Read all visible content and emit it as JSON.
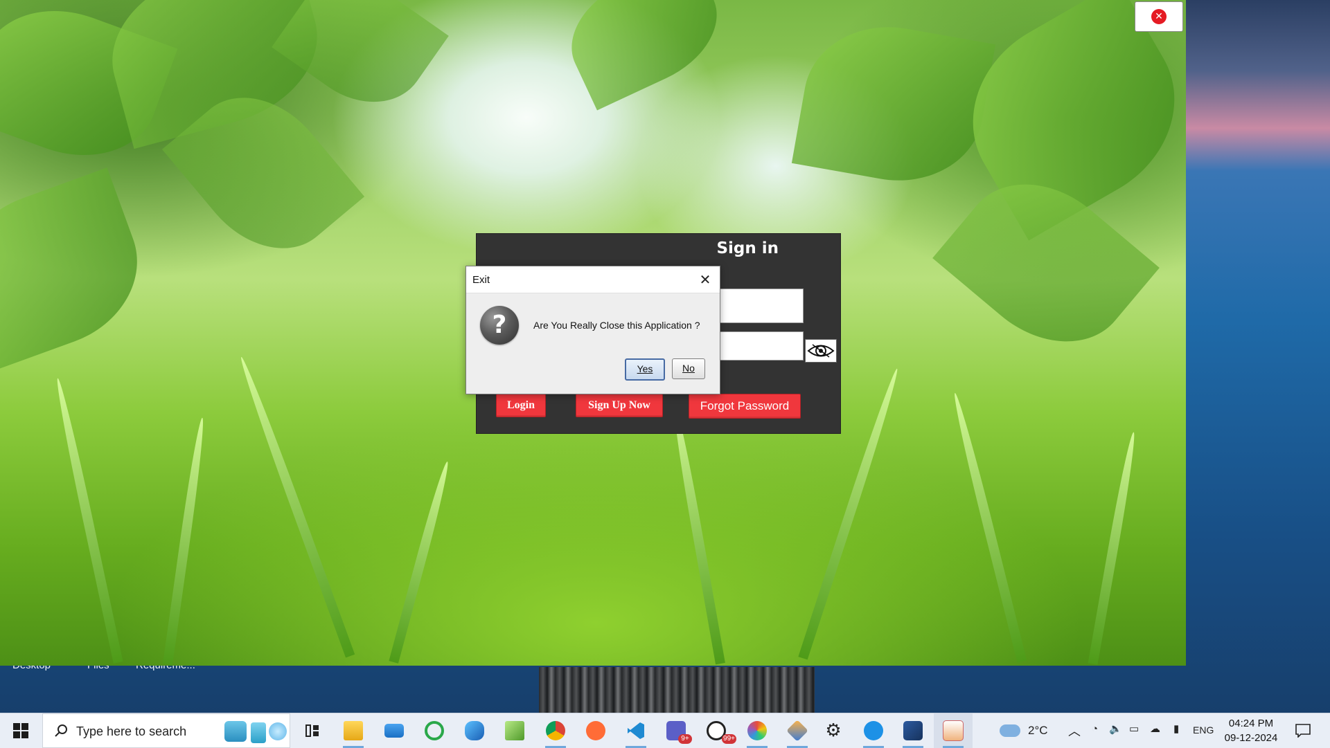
{
  "desktop": {
    "labels": [
      "Desktop",
      "Files",
      "Requireme..."
    ]
  },
  "app": {
    "signin_title": "Sign in",
    "buttons": {
      "login": "Login",
      "signup": "Sign Up Now",
      "forgot": "Forgot Password"
    },
    "close_icon": "close-icon",
    "eye_icon": "eye-icon"
  },
  "dialog": {
    "title": "Exit",
    "message": "Are You Really Close this Application ?",
    "yes_label": "Yes",
    "no_label": "No",
    "close_glyph": "✕",
    "icon": "question-icon"
  },
  "taskbar": {
    "search_placeholder": "Type here to search",
    "pinned": [
      {
        "name": "task-view",
        "icon": "task-view-icon"
      },
      {
        "name": "file-explorer",
        "icon": "folder-icon"
      },
      {
        "name": "mail",
        "icon": "mail-icon"
      },
      {
        "name": "green-circle-app",
        "icon": "refresh-icon"
      },
      {
        "name": "edge-like-app",
        "icon": "browser-icon"
      },
      {
        "name": "notepad-plus",
        "icon": "notepad-icon"
      },
      {
        "name": "chrome",
        "icon": "chrome-icon"
      },
      {
        "name": "postman",
        "icon": "postman-icon"
      },
      {
        "name": "vscode",
        "icon": "vscode-icon"
      },
      {
        "name": "teams",
        "icon": "teams-icon",
        "badge": "9+"
      },
      {
        "name": "whatsapp",
        "icon": "whatsapp-icon",
        "badge": "99+"
      },
      {
        "name": "paint",
        "icon": "paint-icon"
      },
      {
        "name": "cube-app",
        "icon": "cube-icon"
      },
      {
        "name": "settings",
        "icon": "gear-icon"
      },
      {
        "name": "docker",
        "icon": "docker-icon"
      },
      {
        "name": "eclipse",
        "icon": "eclipse-icon"
      },
      {
        "name": "java",
        "icon": "java-icon"
      }
    ],
    "weather": "2°C",
    "language": "ENG",
    "time": "04:24 PM",
    "date": "09-12-2024"
  }
}
